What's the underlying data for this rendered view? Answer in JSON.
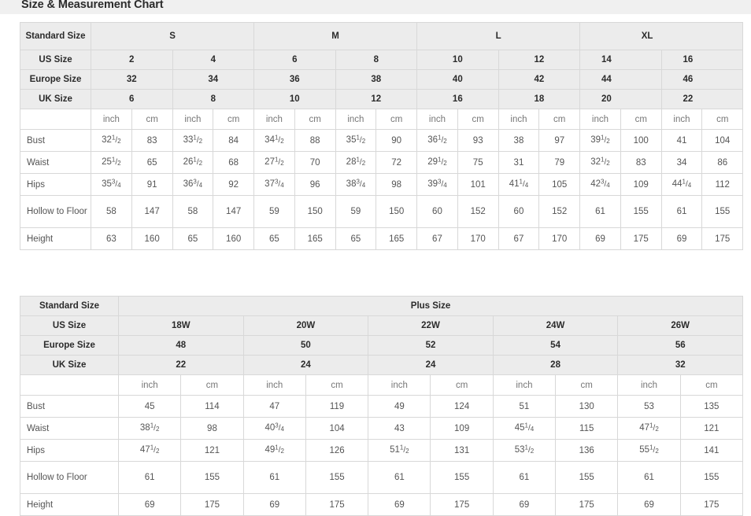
{
  "page_title": "Size & Measurement Chart",
  "theme": {
    "title_bar_bg": "#f0f0f0",
    "header_cell_bg": "#ececec",
    "body_cell_bg": "#ffffff",
    "border": "#d8d8d8",
    "outer_border": "#c8c8c8",
    "header_text": "#2b2b2b",
    "body_text": "#555555",
    "unit_text": "#777777"
  },
  "standard_table": {
    "row_label_header": "Standard Size",
    "groups": [
      {
        "label": "S",
        "span": 4
      },
      {
        "label": "M",
        "span": 4
      },
      {
        "label": "L",
        "span": 4
      },
      {
        "label": "XL",
        "span": 4
      }
    ],
    "size_rows": [
      {
        "label": "US Size",
        "values": [
          "2",
          "4",
          "6",
          "8",
          "10",
          "12",
          "14",
          "16"
        ]
      },
      {
        "label": "Europe Size",
        "values": [
          "32",
          "34",
          "36",
          "38",
          "40",
          "42",
          "44",
          "46"
        ]
      },
      {
        "label": "UK Size",
        "values": [
          "6",
          "8",
          "10",
          "12",
          "16",
          "18",
          "20",
          "22"
        ]
      }
    ],
    "unit_row": {
      "label": "",
      "units": [
        "inch",
        "cm",
        "inch",
        "cm",
        "inch",
        "cm",
        "inch",
        "cm",
        "inch",
        "cm",
        "inch",
        "cm",
        "inch",
        "cm",
        "inch",
        "cm"
      ]
    },
    "measurements": [
      {
        "label": "Bust",
        "cells": [
          {
            "whole": "32",
            "num": "1",
            "den": "2"
          },
          {
            "whole": "83"
          },
          {
            "whole": "33",
            "num": "1",
            "den": "2"
          },
          {
            "whole": "84"
          },
          {
            "whole": "34",
            "num": "1",
            "den": "2"
          },
          {
            "whole": "88"
          },
          {
            "whole": "35",
            "num": "1",
            "den": "2"
          },
          {
            "whole": "90"
          },
          {
            "whole": "36",
            "num": "1",
            "den": "2"
          },
          {
            "whole": "93"
          },
          {
            "whole": "38"
          },
          {
            "whole": "97"
          },
          {
            "whole": "39",
            "num": "1",
            "den": "2"
          },
          {
            "whole": "100"
          },
          {
            "whole": "41"
          },
          {
            "whole": "104"
          }
        ]
      },
      {
        "label": "Waist",
        "cells": [
          {
            "whole": "25",
            "num": "1",
            "den": "2"
          },
          {
            "whole": "65"
          },
          {
            "whole": "26",
            "num": "1",
            "den": "2"
          },
          {
            "whole": "68"
          },
          {
            "whole": "27",
            "num": "1",
            "den": "2"
          },
          {
            "whole": "70"
          },
          {
            "whole": "28",
            "num": "1",
            "den": "2"
          },
          {
            "whole": "72"
          },
          {
            "whole": "29",
            "num": "1",
            "den": "2"
          },
          {
            "whole": "75"
          },
          {
            "whole": "31"
          },
          {
            "whole": "79"
          },
          {
            "whole": "32",
            "num": "1",
            "den": "2"
          },
          {
            "whole": "83"
          },
          {
            "whole": "34"
          },
          {
            "whole": "86"
          }
        ]
      },
      {
        "label": "Hips",
        "cells": [
          {
            "whole": "35",
            "num": "3",
            "den": "4"
          },
          {
            "whole": "91"
          },
          {
            "whole": "36",
            "num": "3",
            "den": "4"
          },
          {
            "whole": "92"
          },
          {
            "whole": "37",
            "num": "3",
            "den": "4"
          },
          {
            "whole": "96"
          },
          {
            "whole": "38",
            "num": "3",
            "den": "4"
          },
          {
            "whole": "98"
          },
          {
            "whole": "39",
            "num": "3",
            "den": "4"
          },
          {
            "whole": "101"
          },
          {
            "whole": "41",
            "num": "1",
            "den": "4"
          },
          {
            "whole": "105"
          },
          {
            "whole": "42",
            "num": "3",
            "den": "4"
          },
          {
            "whole": "109"
          },
          {
            "whole": "44",
            "num": "1",
            "den": "4"
          },
          {
            "whole": "112"
          }
        ]
      },
      {
        "label": "Hollow to Floor",
        "tall": true,
        "cells": [
          {
            "whole": "58"
          },
          {
            "whole": "147"
          },
          {
            "whole": "58"
          },
          {
            "whole": "147"
          },
          {
            "whole": "59"
          },
          {
            "whole": "150"
          },
          {
            "whole": "59"
          },
          {
            "whole": "150"
          },
          {
            "whole": "60"
          },
          {
            "whole": "152"
          },
          {
            "whole": "60"
          },
          {
            "whole": "152"
          },
          {
            "whole": "61"
          },
          {
            "whole": "155"
          },
          {
            "whole": "61"
          },
          {
            "whole": "155"
          }
        ]
      },
      {
        "label": "Height",
        "cells": [
          {
            "whole": "63"
          },
          {
            "whole": "160"
          },
          {
            "whole": "65"
          },
          {
            "whole": "160"
          },
          {
            "whole": "65"
          },
          {
            "whole": "165"
          },
          {
            "whole": "65"
          },
          {
            "whole": "165"
          },
          {
            "whole": "67"
          },
          {
            "whole": "170"
          },
          {
            "whole": "67"
          },
          {
            "whole": "170"
          },
          {
            "whole": "69"
          },
          {
            "whole": "175"
          },
          {
            "whole": "69"
          },
          {
            "whole": "175"
          }
        ]
      }
    ]
  },
  "plus_table": {
    "row_label_header": "Standard Size",
    "group_label": "Plus Size",
    "size_rows": [
      {
        "label": "US Size",
        "values": [
          "18W",
          "20W",
          "22W",
          "24W",
          "26W"
        ]
      },
      {
        "label": "Europe Size",
        "values": [
          "48",
          "50",
          "52",
          "54",
          "56"
        ]
      },
      {
        "label": "UK Size",
        "values": [
          "22",
          "24",
          "24",
          "28",
          "32"
        ]
      }
    ],
    "unit_row": {
      "label": "",
      "units": [
        "inch",
        "cm",
        "inch",
        "cm",
        "inch",
        "cm",
        "inch",
        "cm",
        "inch",
        "cm"
      ]
    },
    "measurements": [
      {
        "label": "Bust",
        "cells": [
          {
            "whole": "45"
          },
          {
            "whole": "114"
          },
          {
            "whole": "47"
          },
          {
            "whole": "119"
          },
          {
            "whole": "49"
          },
          {
            "whole": "124"
          },
          {
            "whole": "51"
          },
          {
            "whole": "130"
          },
          {
            "whole": "53"
          },
          {
            "whole": "135"
          }
        ]
      },
      {
        "label": "Waist",
        "cells": [
          {
            "whole": "38",
            "num": "1",
            "den": "2"
          },
          {
            "whole": "98"
          },
          {
            "whole": "40",
            "num": "3",
            "den": "4"
          },
          {
            "whole": "104"
          },
          {
            "whole": "43"
          },
          {
            "whole": "109"
          },
          {
            "whole": "45",
            "num": "1",
            "den": "4"
          },
          {
            "whole": "115"
          },
          {
            "whole": "47",
            "num": "1",
            "den": "2"
          },
          {
            "whole": "121"
          }
        ]
      },
      {
        "label": "Hips",
        "cells": [
          {
            "whole": "47",
            "num": "1",
            "den": "2"
          },
          {
            "whole": "121"
          },
          {
            "whole": "49",
            "num": "1",
            "den": "2"
          },
          {
            "whole": "126"
          },
          {
            "whole": "51",
            "num": "1",
            "den": "2"
          },
          {
            "whole": "131"
          },
          {
            "whole": "53",
            "num": "1",
            "den": "2"
          },
          {
            "whole": "136"
          },
          {
            "whole": "55",
            "num": "1",
            "den": "2"
          },
          {
            "whole": "141"
          }
        ]
      },
      {
        "label": "Hollow to Floor",
        "tall": true,
        "cells": [
          {
            "whole": "61"
          },
          {
            "whole": "155"
          },
          {
            "whole": "61"
          },
          {
            "whole": "155"
          },
          {
            "whole": "61"
          },
          {
            "whole": "155"
          },
          {
            "whole": "61"
          },
          {
            "whole": "155"
          },
          {
            "whole": "61"
          },
          {
            "whole": "155"
          }
        ]
      },
      {
        "label": "Height",
        "cells": [
          {
            "whole": "69"
          },
          {
            "whole": "175"
          },
          {
            "whole": "69"
          },
          {
            "whole": "175"
          },
          {
            "whole": "69"
          },
          {
            "whole": "175"
          },
          {
            "whole": "69"
          },
          {
            "whole": "175"
          },
          {
            "whole": "69"
          },
          {
            "whole": "175"
          }
        ]
      }
    ]
  }
}
